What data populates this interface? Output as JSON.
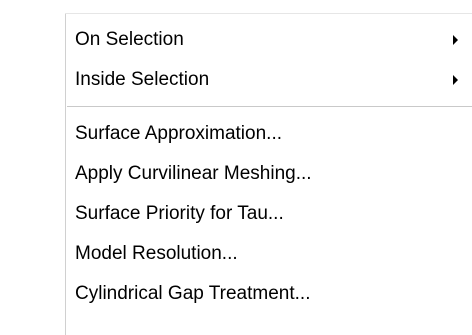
{
  "menu": {
    "submenu_items": [
      {
        "label": "On Selection"
      },
      {
        "label": "Inside Selection"
      }
    ],
    "items": [
      {
        "label": "Surface Approximation..."
      },
      {
        "label": "Apply Curvilinear Meshing..."
      },
      {
        "label": "Surface Priority for Tau..."
      },
      {
        "label": "Model Resolution..."
      },
      {
        "label": "Cylindrical Gap Treatment..."
      }
    ]
  }
}
